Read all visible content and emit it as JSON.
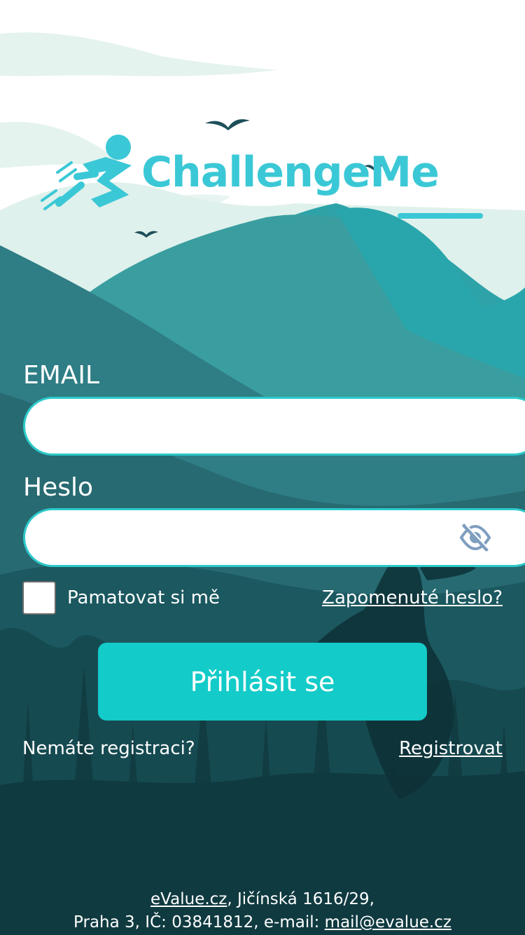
{
  "app": {
    "logo_text": "ChallengeMe"
  },
  "form": {
    "email_label": "EMAIL",
    "email_value": "",
    "password_label": "Heslo",
    "password_value": "",
    "password_visibility_icon": "eye-off-icon",
    "remember_label": "Pamatovat si mě",
    "remember_checked": false,
    "forgot_link": "Zapomenuté heslo?",
    "login_button": "Přihlásit se",
    "no_account_text": "Nemáte registraci?",
    "register_link": "Registrovat"
  },
  "footer": {
    "company_link": "eValue.cz",
    "line1_rest": ", Jičínská 1616/29,",
    "line2_prefix": "Praha 3, IČ: 03841812, e-mail: ",
    "email_link": "mail@evalue.cz"
  },
  "colors": {
    "accent": "#13cbc8",
    "logo": "#3bc8d6",
    "input_border": "#2cc9c9",
    "eye_icon": "#7f9ec0"
  }
}
